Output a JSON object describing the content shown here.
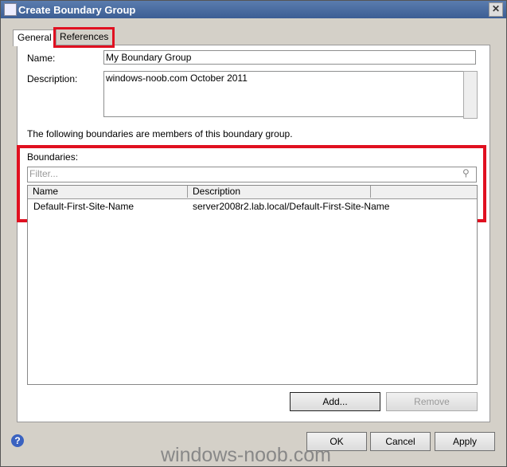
{
  "window": {
    "title": "Create Boundary Group",
    "close": "✕"
  },
  "tabs": [
    {
      "label": "General"
    },
    {
      "label": "References"
    }
  ],
  "form": {
    "name_label": "Name:",
    "name_value": "My Boundary Group",
    "description_label": "Description:",
    "description_value": "windows-noob.com October 2011",
    "members_text": "The following boundaries are members of this boundary group.",
    "boundaries_label": "Boundaries:",
    "filter_placeholder": "Filter..."
  },
  "table": {
    "columns": [
      "Name",
      "Description"
    ],
    "rows": [
      [
        "Default-First-Site-Name",
        "server2008r2.lab.local/Default-First-Site-Name"
      ]
    ]
  },
  "buttons": {
    "add": "Add...",
    "remove": "Remove",
    "ok": "OK",
    "cancel": "Cancel",
    "apply": "Apply"
  },
  "watermark": "windows-noob.com",
  "colors": {
    "highlight": "#e01020",
    "titlebar": "#4a6ca2"
  }
}
